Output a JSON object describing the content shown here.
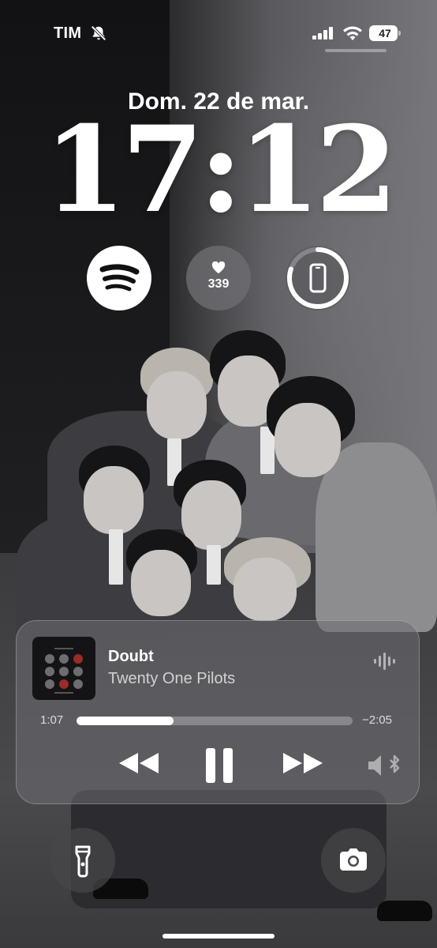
{
  "status_bar": {
    "carrier": "TIM",
    "silent_icon": "bell-slash-icon",
    "signal_icon": "cellular-signal-icon",
    "wifi_icon": "wifi-icon",
    "battery_level": "47"
  },
  "lock_screen": {
    "date": "Dom. 22 de mar.",
    "time": "17:12"
  },
  "widgets": {
    "spotify_icon": "spotify-logo-icon",
    "health_icon": "heart-icon",
    "health_value": "339",
    "device_icon": "iphone-icon",
    "device_battery_fraction": 0.8
  },
  "now_playing": {
    "title": "Doubt",
    "artist": "Twenty One Pilots",
    "elapsed": "1:07",
    "remaining": "−2:05",
    "progress_fraction": 0.35,
    "controls": [
      "rewind-icon",
      "pause-icon",
      "fast-forward-icon",
      "airplay-speaker-icon"
    ]
  },
  "quick_actions": {
    "left_icon": "flashlight-icon",
    "right_icon": "camera-icon"
  },
  "colors": {
    "accent": "#ffffff",
    "artwork_red": "#9b2b25"
  }
}
